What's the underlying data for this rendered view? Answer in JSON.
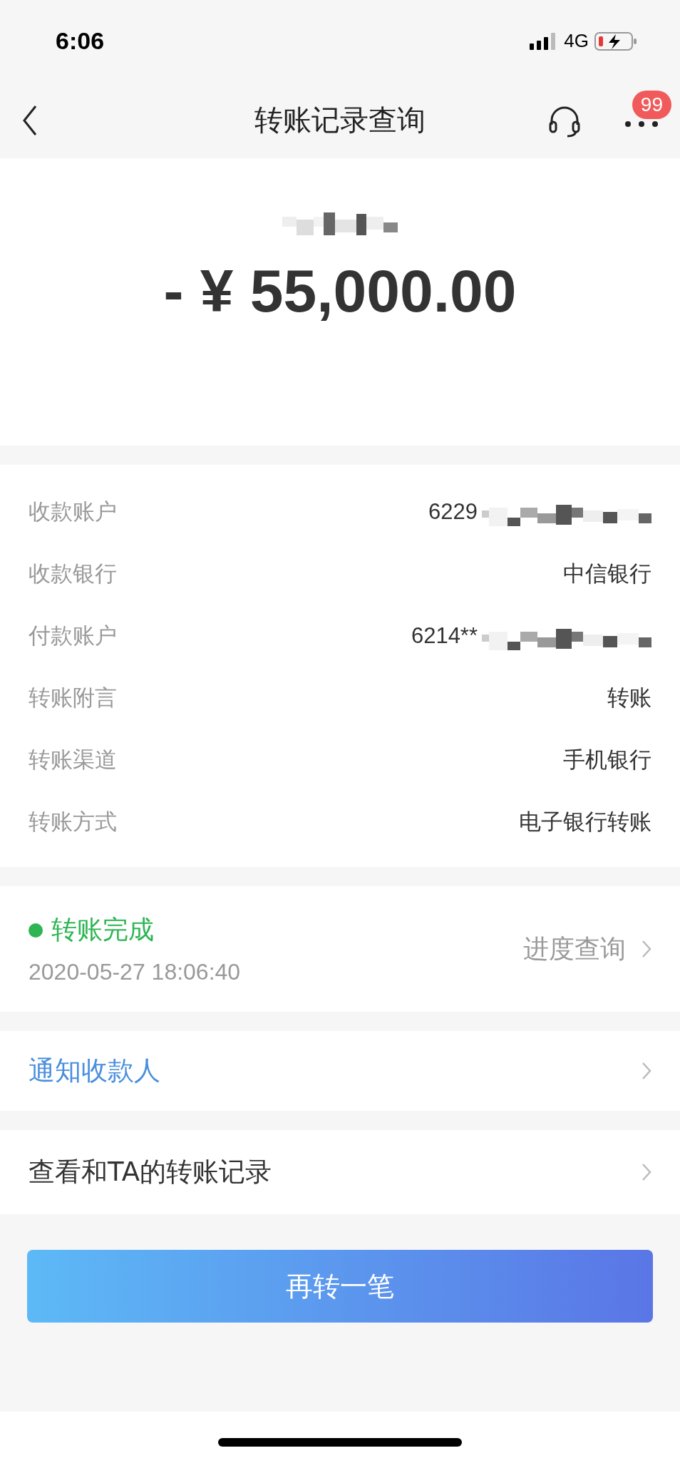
{
  "status_bar": {
    "time": "6:06",
    "network": "4G"
  },
  "nav": {
    "title": "转账记录查询",
    "badge": "99"
  },
  "summary": {
    "amount": "- ¥ 55,000.00"
  },
  "details": [
    {
      "label": "收款账户",
      "value": "6229",
      "masked": true
    },
    {
      "label": "收款银行",
      "value": "中信银行",
      "masked": false
    },
    {
      "label": "付款账户",
      "value": "6214**",
      "masked": true
    },
    {
      "label": "转账附言",
      "value": "转账",
      "masked": false
    },
    {
      "label": "转账渠道",
      "value": "手机银行",
      "masked": false
    },
    {
      "label": "转账方式",
      "value": "电子银行转账",
      "masked": false
    }
  ],
  "progress": {
    "status": "转账完成",
    "color": "#2db552",
    "time": "2020-05-27 18:06:40",
    "link": "进度查询"
  },
  "links": [
    {
      "label": "通知收款人",
      "kind": "accent"
    },
    {
      "label": "查看和TA的转账记录",
      "kind": "plain"
    }
  ],
  "button": "再转一笔"
}
